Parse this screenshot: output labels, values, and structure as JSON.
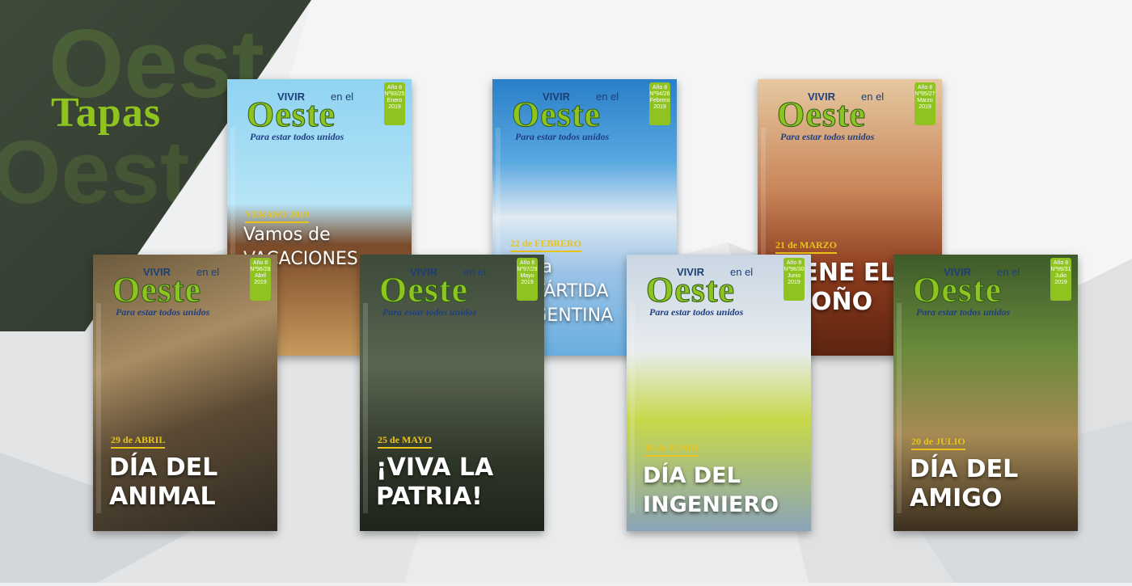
{
  "page": {
    "title": "Tapas"
  },
  "colors": {
    "accent": "#8fc31f",
    "date": "#e9c21a"
  },
  "masthead": {
    "vivir": "VIVIR",
    "enel": "en el",
    "oeste": "Oeste",
    "tagline": "Para estar todos unidos"
  },
  "covers": [
    {
      "month": "Enero",
      "issue": "Nº93/25",
      "year": "2019",
      "date": "VERANO 2019",
      "headline": "Vamos de\nVACACIONES"
    },
    {
      "month": "Febrero",
      "issue": "Nº94/26",
      "year": "2019",
      "date": "22 de FEBRERO",
      "headline": "de la\nANTÁRTIDA\nARGENTINA"
    },
    {
      "month": "Marzo",
      "issue": "Nº95/27",
      "year": "2019",
      "date": "21 de MARZO",
      "headline": "VIENE EL\nOTOÑO"
    },
    {
      "month": "Abril",
      "issue": "Nº96/28",
      "year": "2019",
      "date": "29 de ABRIL",
      "headline": "DÍA DEL\nANIMAL"
    },
    {
      "month": "Mayo",
      "issue": "Nº97/29",
      "year": "2019",
      "date": "25 de MAYO",
      "headline": "¡VIVA LA\nPATRIA!"
    },
    {
      "month": "Junio",
      "issue": "Nº98/30",
      "year": "2019",
      "date": "16 de JUNIO",
      "headline": "DÍA DEL\nINGENIERO"
    },
    {
      "month": "Julio",
      "issue": "Nº99/31",
      "year": "2019",
      "date": "20 de JULIO",
      "headline": "DÍA DEL\nAMIGO"
    }
  ],
  "issue_prefix": "Año 8"
}
